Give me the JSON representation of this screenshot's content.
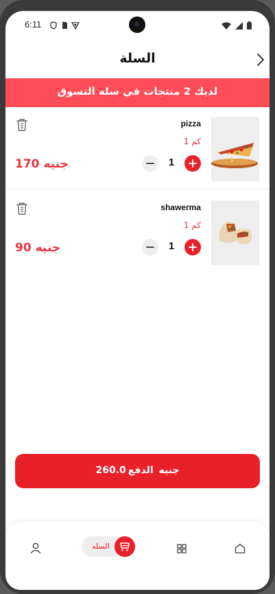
{
  "status_bar": {
    "time": "6:11"
  },
  "header": {
    "title": "السلة"
  },
  "banner": {
    "text": "لديك 2 منتجات في سله التسوق"
  },
  "items": [
    {
      "name": "pizza",
      "qty_label": "1 كم",
      "quantity": "1",
      "price": "170 جنيه"
    },
    {
      "name": "shawerma",
      "qty_label": "1 كم",
      "quantity": "1",
      "price": "90 جنيه"
    }
  ],
  "checkout": {
    "label": "الدفع",
    "amount": "260.0جنيه"
  },
  "bottom_nav": {
    "cart_label": "السله"
  },
  "colors": {
    "accent": "#e8202a",
    "banner": "#ff4d57",
    "price": "#e8343e"
  }
}
